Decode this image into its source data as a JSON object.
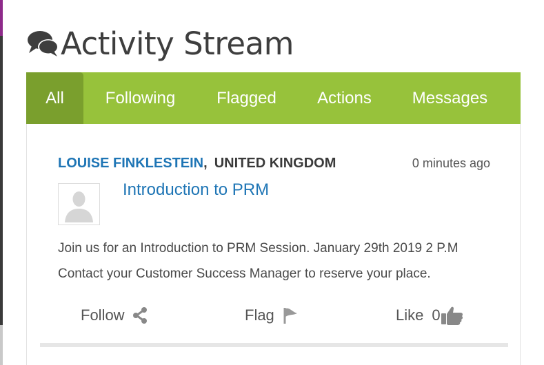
{
  "page": {
    "title": "Activity Stream"
  },
  "tabs": [
    {
      "label": "All",
      "active": true
    },
    {
      "label": "Following",
      "active": false
    },
    {
      "label": "Flagged",
      "active": false
    },
    {
      "label": "Actions",
      "active": false
    },
    {
      "label": "Messages",
      "active": false
    }
  ],
  "post": {
    "author": "LOUISE FINKLESTEIN",
    "separator": ",",
    "location": "UNITED KINGDOM",
    "timestamp": "0 minutes ago",
    "title": "Introduction to PRM",
    "body_lines": [
      "Join us for an Introduction to PRM Session. January 29th 2019 2 P.M",
      "Contact your Customer Success Manager to reserve your place."
    ],
    "actions": {
      "follow_label": "Follow",
      "flag_label": "Flag",
      "like_label": "Like",
      "like_count": "0"
    }
  },
  "icons": {
    "title_icon": "chat-bubbles-icon",
    "follow_icon": "share-icon",
    "flag_icon": "flag-icon",
    "like_icon": "thumbs-up-icon",
    "avatar": "default-user-avatar"
  },
  "colors": {
    "tab_bar": "#97c23b",
    "tab_active": "#7a9f2d",
    "link": "#1e75b5",
    "icon_gray": "#888888"
  }
}
